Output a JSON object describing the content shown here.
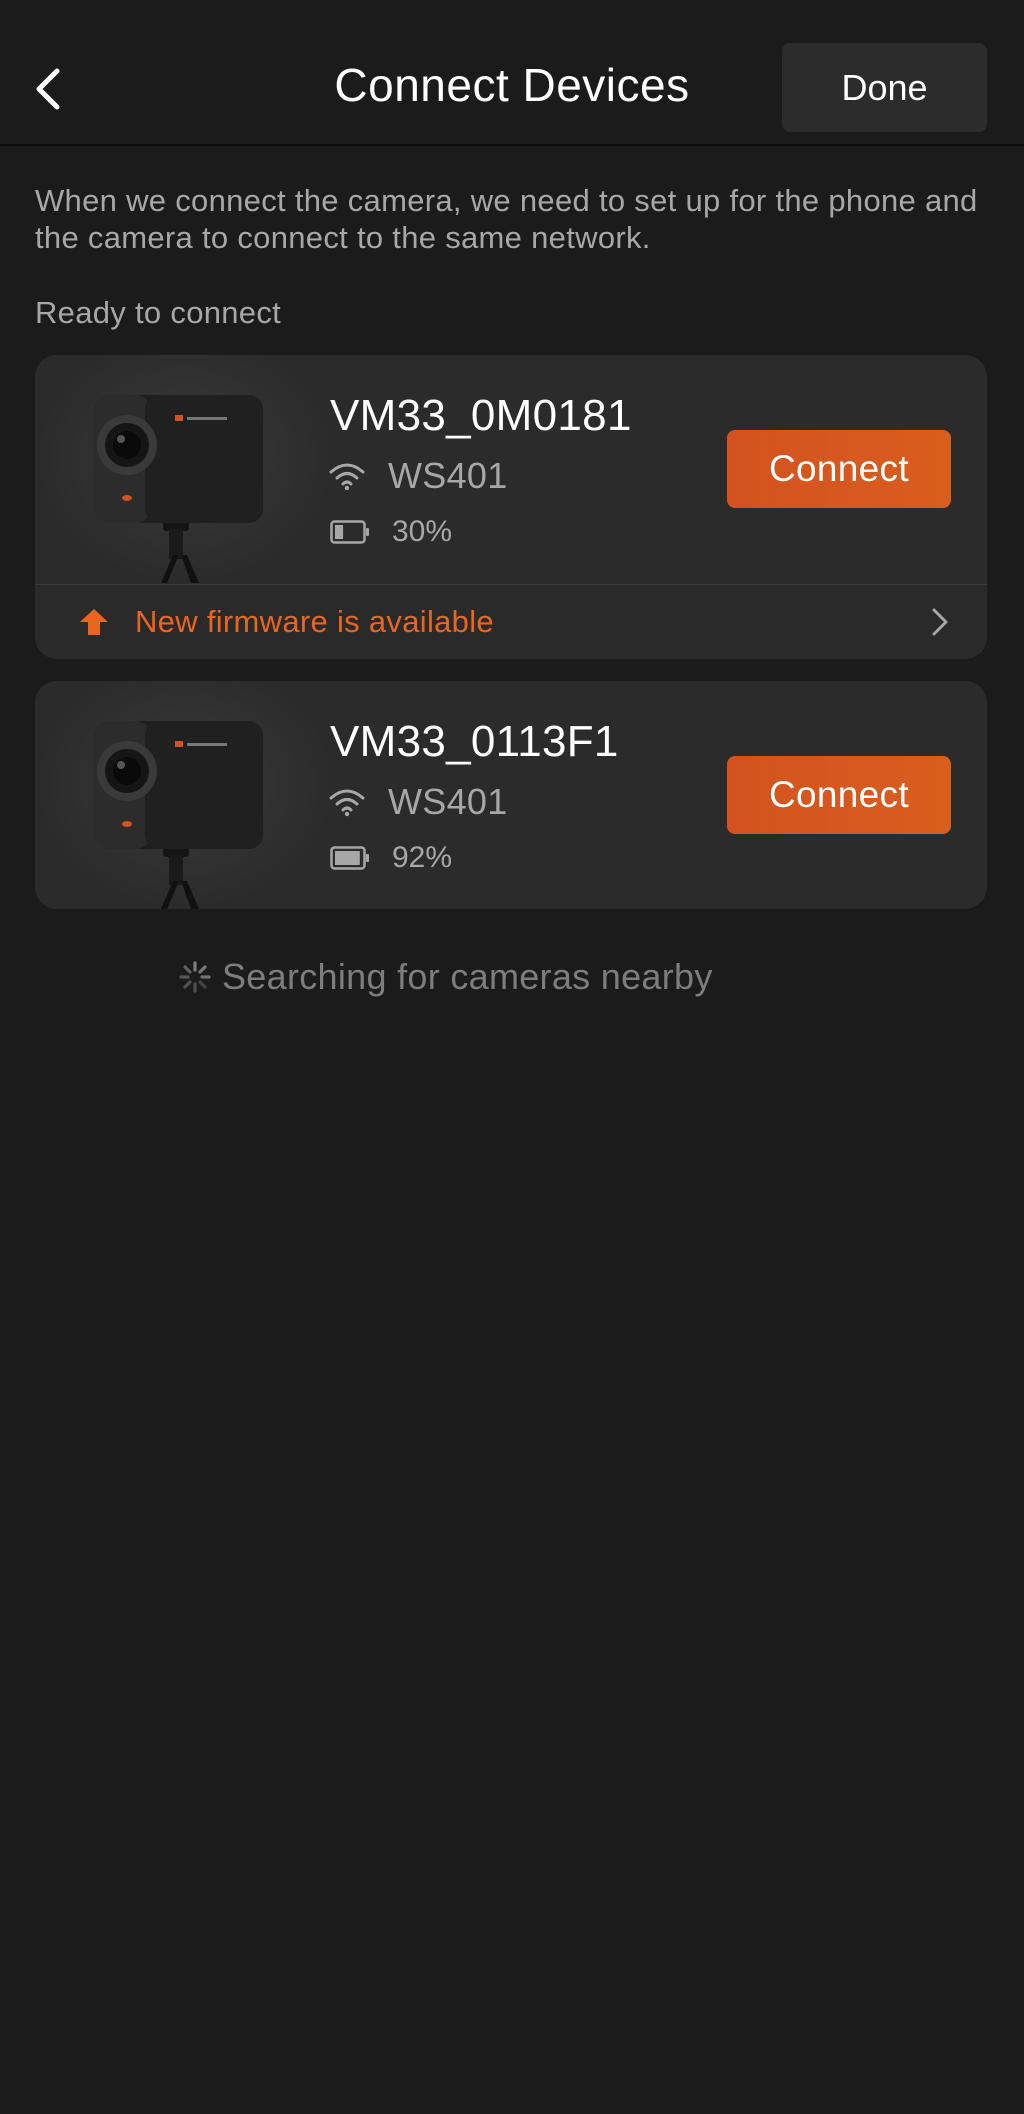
{
  "header": {
    "title": "Connect Devices",
    "done_label": "Done",
    "back_icon": "chevron-left-icon"
  },
  "description": "When we connect the camera, we need to set up for the phone and the camera to connect to the same network.",
  "section_label": "Ready to connect",
  "devices": [
    {
      "name": "VM33_0M0181",
      "network": "WS401",
      "battery": "30%",
      "battery_level": 0.3,
      "connect_label": "Connect",
      "firmware_notice": "New firmware is available"
    },
    {
      "name": "VM33_0113F1",
      "network": "WS401",
      "battery": "92%",
      "battery_level": 0.92,
      "connect_label": "Connect"
    }
  ],
  "searching_text": "Searching for cameras nearby",
  "colors": {
    "background": "#1b1b1b",
    "card": "#2b2b2b",
    "accent": "#d4521f",
    "firmware_text": "#e8661f",
    "muted_text": "#a7a7a7"
  }
}
